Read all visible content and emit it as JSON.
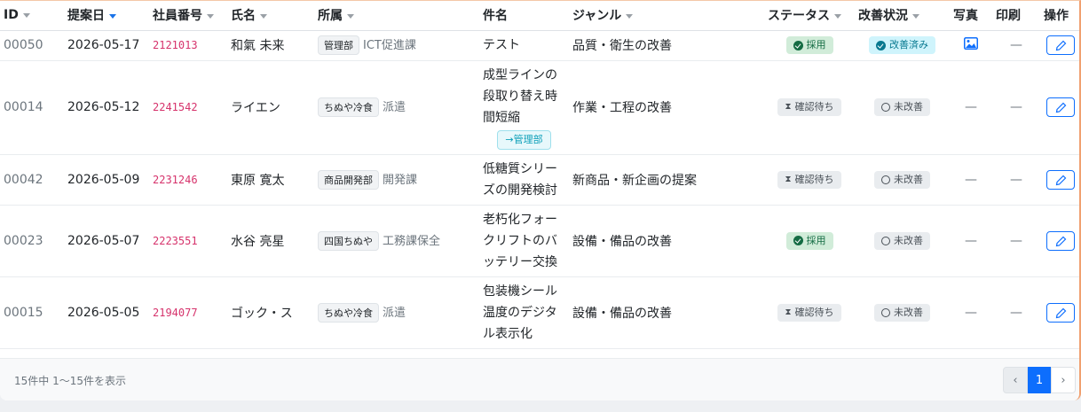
{
  "columns": {
    "id": "ID",
    "date": "提案日",
    "emp": "社員番号",
    "name": "氏名",
    "dept": "所属",
    "subject": "件名",
    "genre": "ジャンル",
    "status": "ステータス",
    "improve": "改善状況",
    "photo": "写真",
    "print": "印刷",
    "action": "操作"
  },
  "rows": [
    {
      "id": "00050",
      "date": "2026-05-17",
      "emp": "2121013",
      "name": "和氣 未来",
      "dept": "管理部",
      "section": "ICT促進課",
      "subject": "テスト",
      "transfer": "",
      "genre": "品質・衛生の改善",
      "status": "採用",
      "improve": "改善済み",
      "photo_icon": "image-icon",
      "print": "—"
    },
    {
      "id": "00014",
      "date": "2026-05-12",
      "emp": "2241542",
      "name": "ライエン",
      "dept": "ちぬや冷食",
      "section": "派遣",
      "subject": "成型ラインの段取り替え時間短縮",
      "transfer": "→管理部",
      "genre": "作業・工程の改善",
      "status": "確認待ち",
      "improve": "未改善",
      "photo_icon": "",
      "photo": "—",
      "print": "—"
    },
    {
      "id": "00042",
      "date": "2026-05-09",
      "emp": "2231246",
      "name": "東原 寛太",
      "dept": "商品開発部",
      "section": "開発課",
      "subject": "低糖質シリーズの開発検討",
      "transfer": "",
      "genre": "新商品・新企画の提案",
      "status": "確認待ち",
      "improve": "未改善",
      "photo_icon": "",
      "photo": "—",
      "print": "—"
    },
    {
      "id": "00023",
      "date": "2026-05-07",
      "emp": "2223551",
      "name": "水谷 亮星",
      "dept": "四国ちぬや",
      "section": "工務課保全",
      "subject": "老朽化フォークリフトのバッテリー交換",
      "transfer": "",
      "genre": "設備・備品の改善",
      "status": "採用",
      "improve": "未改善",
      "photo_icon": "",
      "photo": "—",
      "print": "—"
    },
    {
      "id": "00015",
      "date": "2026-05-05",
      "emp": "2194077",
      "name": "ゴック・ス",
      "dept": "ちぬや冷食",
      "section": "派遣",
      "subject": "包装機シール温度のデジタル表示化",
      "transfer": "",
      "genre": "設備・備品の改善",
      "status": "確認待ち",
      "improve": "未改善",
      "photo_icon": "",
      "photo": "—",
      "print": "—"
    }
  ],
  "footer": {
    "info": "15件中 1〜15件を表示",
    "current_page": "1",
    "prev": "‹",
    "next": "›"
  },
  "colors": {
    "accent": "#0d6efd",
    "adopt": "#146c43",
    "done": "#087990",
    "emp": "#d6336c"
  }
}
